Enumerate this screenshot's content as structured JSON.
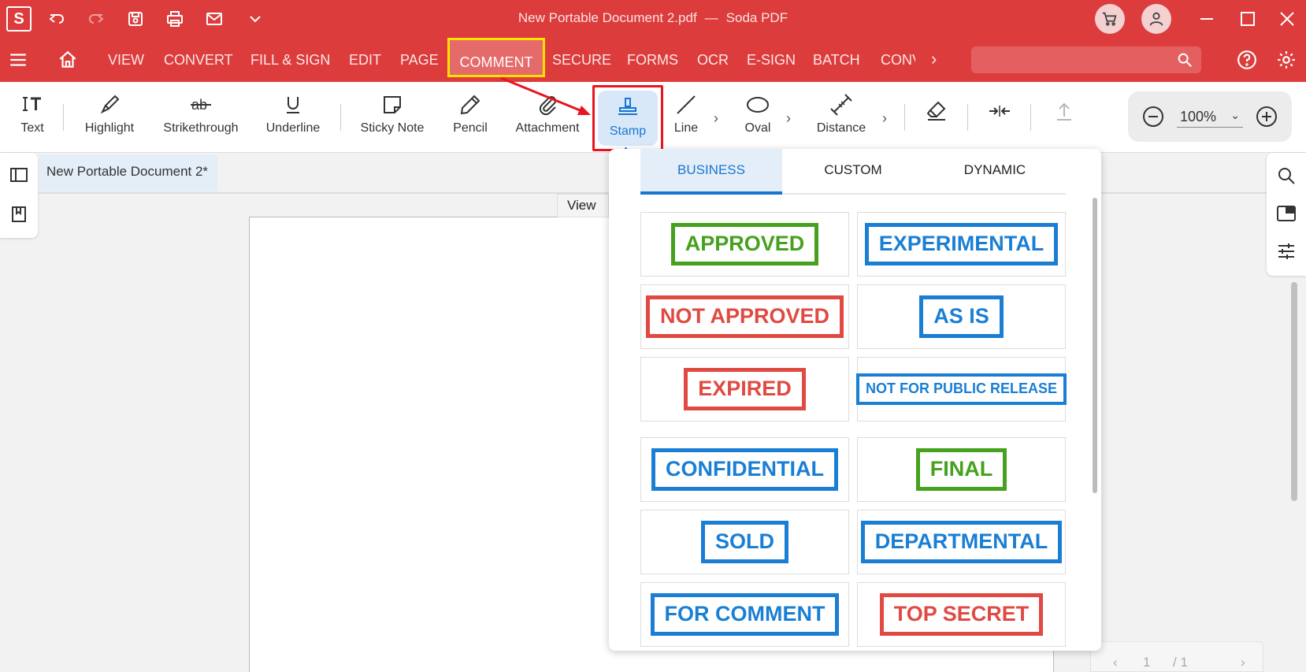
{
  "titlebar": {
    "logo": "S",
    "document_name": "New Portable Document 2.pdf",
    "separator": "—",
    "app_name": "Soda PDF"
  },
  "menu": {
    "items": [
      "VIEW",
      "CONVERT",
      "FILL & SIGN",
      "EDIT",
      "PAGE",
      "COMMENT",
      "SECURE",
      "FORMS",
      "OCR",
      "E-SIGN",
      "BATCH",
      "CONVERT"
    ],
    "active": "COMMENT",
    "search_placeholder": ""
  },
  "toolbar": {
    "tools": [
      {
        "label": "Text",
        "icon": "text-tool-icon"
      },
      {
        "label": "Highlight",
        "icon": "highlighter-icon"
      },
      {
        "label": "Strikethrough",
        "icon": "strikethrough-icon"
      },
      {
        "label": "Underline",
        "icon": "underline-icon"
      },
      {
        "label": "Sticky Note",
        "icon": "sticky-note-icon"
      },
      {
        "label": "Pencil",
        "icon": "pencil-icon"
      },
      {
        "label": "Attachment",
        "icon": "paperclip-icon"
      },
      {
        "label": "Stamp",
        "icon": "stamp-icon"
      },
      {
        "label": "Line",
        "icon": "line-icon"
      },
      {
        "label": "Oval",
        "icon": "oval-icon"
      },
      {
        "label": "Distance",
        "icon": "distance-icon"
      }
    ],
    "selected_tool": "Stamp",
    "zoom": "100%"
  },
  "document": {
    "tab_title": "New Portable Document 2*",
    "view_button": "View",
    "page_current": "1",
    "page_total": "/ 1"
  },
  "stamp_panel": {
    "tabs": [
      "BUSINESS",
      "CUSTOM",
      "DYNAMIC"
    ],
    "selected_tab": "BUSINESS",
    "stamps": [
      {
        "label": "APPROVED",
        "color": "#46a11e"
      },
      {
        "label": "EXPERIMENTAL",
        "color": "#1a7fd4"
      },
      {
        "label": "NOT APPROVED",
        "color": "#e04a42"
      },
      {
        "label": "AS IS",
        "color": "#1a7fd4"
      },
      {
        "label": "EXPIRED",
        "color": "#e04a42"
      },
      {
        "label": "NOT FOR PUBLIC RELEASE",
        "color": "#1a7fd4"
      },
      {
        "label": "CONFIDENTIAL",
        "color": "#1a7fd4"
      },
      {
        "label": "FINAL",
        "color": "#46a11e"
      },
      {
        "label": "SOLD",
        "color": "#1a7fd4"
      },
      {
        "label": "DEPARTMENTAL",
        "color": "#1a7fd4"
      },
      {
        "label": "FOR COMMENT",
        "color": "#1a7fd4"
      },
      {
        "label": "TOP SECRET",
        "color": "#e04a42"
      }
    ]
  },
  "colors": {
    "brand_red": "#dc3c3c",
    "accent_blue": "#1876d2",
    "highlight_yellow": "#ffe100",
    "annotation_red": "#e8141e"
  }
}
